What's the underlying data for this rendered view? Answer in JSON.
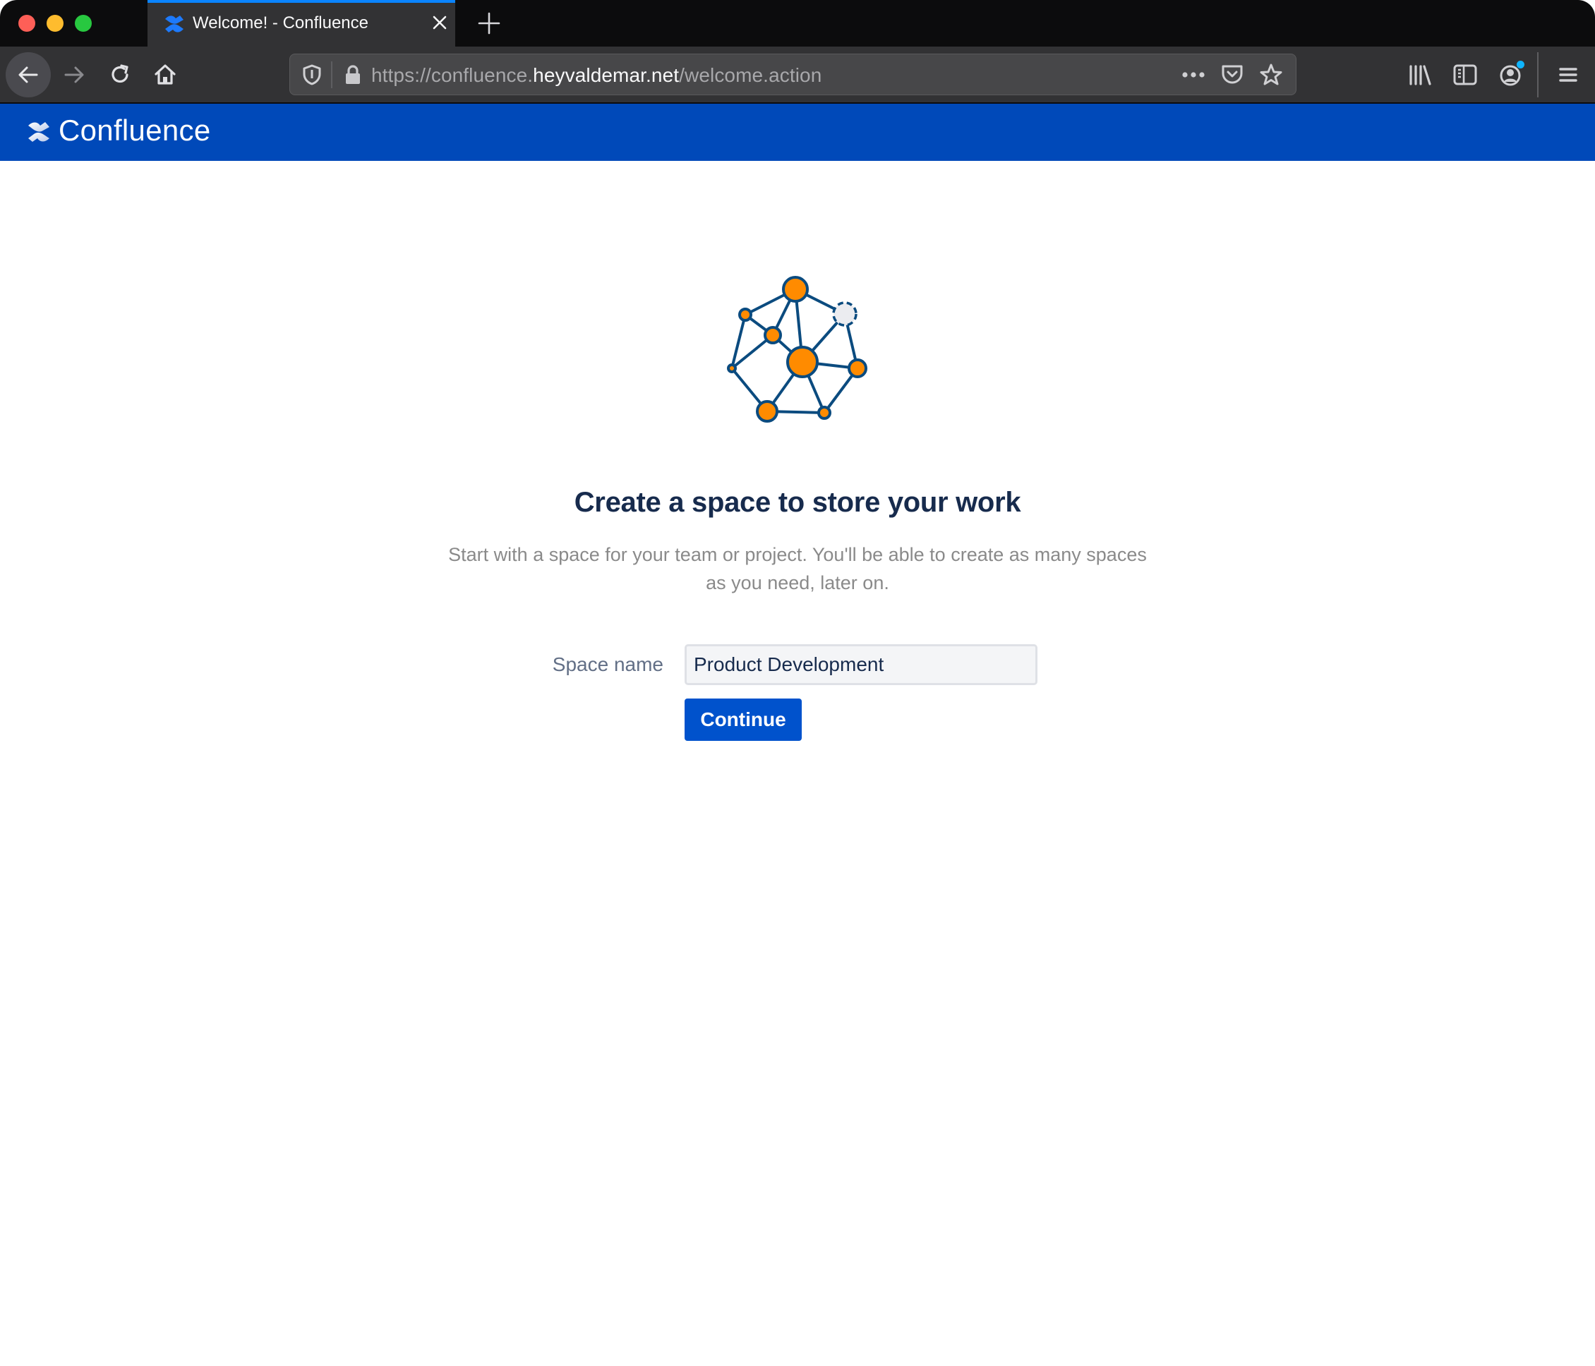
{
  "browser": {
    "tab": {
      "title": "Welcome! - Confluence",
      "favicon": "confluence-logo-icon"
    },
    "url": {
      "prefix": "https://confluence.",
      "host": "heyvaldemar.net",
      "path": "/welcome.action"
    },
    "toolbar_icons": [
      "back-icon",
      "forward-icon",
      "reload-icon",
      "home-icon",
      "shield-icon",
      "lock-icon",
      "more-icon",
      "pocket-icon",
      "bookmark-star-icon",
      "library-icon",
      "sidebar-icon",
      "account-icon",
      "menu-icon"
    ],
    "accent_color": "#0a84ff",
    "notification_dot_color": "#0fb5ff"
  },
  "app": {
    "name": "Confluence",
    "header_color": "#0049b9"
  },
  "main": {
    "illustration": "network-nodes-illustration",
    "heading": "Create a space to store your work",
    "subtext": "Start with a space for your team or project. You'll be able to create as many spaces as you need, later on.",
    "form": {
      "space_name_label": "Space name",
      "space_name_value": "Product Development",
      "continue_label": "Continue"
    },
    "colors": {
      "node_fill": "#ff8b00",
      "node_stroke": "#0b4b7f",
      "placeholder_node_fill": "#ebecf0",
      "button": "#0052cc",
      "heading": "#172b4d"
    }
  }
}
